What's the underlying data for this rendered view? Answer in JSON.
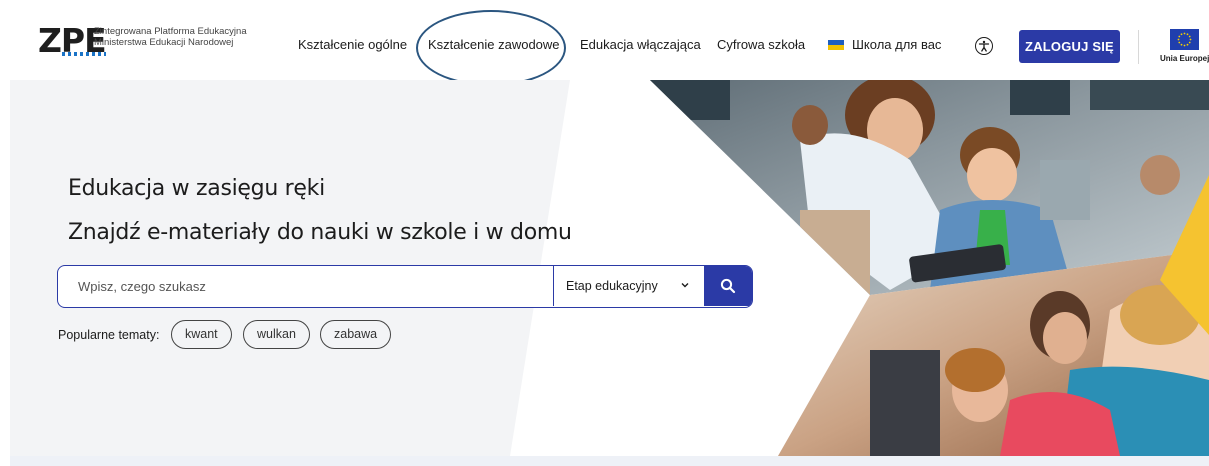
{
  "header": {
    "logo": {
      "mark": "ZPE",
      "line1": "Zintegrowana Platforma Edukacyjna",
      "line2": "Ministerstwa Edukacji Narodowej"
    },
    "nav": [
      {
        "label": "Kształcenie ogólne"
      },
      {
        "label": "Kształcenie zawodowe"
      },
      {
        "label": "Edukacja włączająca"
      },
      {
        "label": "Cyfrowa szkoła"
      },
      {
        "label": "Школа для вас"
      }
    ],
    "accessibility_icon": "accessibility-icon",
    "login_label": "ZALOGUJ SIĘ",
    "eu_label": "Unia Europejska"
  },
  "hero": {
    "title_line1": "Edukacja w zasięgu ręki",
    "title_line2": "Znajdź e-materiały do nauki w szkole i w domu",
    "search": {
      "placeholder": "Wpisz, czego szukasz",
      "value": "",
      "stage_selected": "Etap edukacyjny",
      "button_icon": "search-icon"
    },
    "popular_label": "Popularne tematy:",
    "popular_topics": [
      "kwant",
      "wulkan",
      "zabawa"
    ]
  },
  "colors": {
    "brand": "#2b3aa6",
    "annotation": "#2b5680",
    "hero_bg": "#f3f4f6",
    "accent_yellow": "#f5c330"
  }
}
